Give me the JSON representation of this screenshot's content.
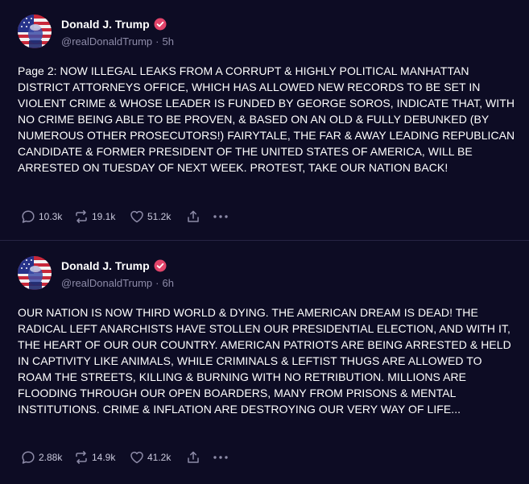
{
  "posts": [
    {
      "author": {
        "display_name": "Donald J. Trump",
        "handle": "@realDonaldTrump",
        "time": "5h",
        "verified_icon": "verified-badge-icon",
        "avatar": "avatar-icon"
      },
      "text": "Page 2: NOW ILLEGAL LEAKS FROM A CORRUPT & HIGHLY POLITICAL MANHATTAN DISTRICT ATTORNEYS OFFICE, WHICH HAS ALLOWED NEW RECORDS TO BE SET IN VIOLENT CRIME & WHOSE LEADER IS FUNDED BY GEORGE SOROS, INDICATE THAT, WITH NO CRIME BEING ABLE TO BE PROVEN, & BASED ON AN OLD & FULLY DEBUNKED (BY NUMEROUS OTHER PROSECUTORS!) FAIRYTALE, THE FAR & AWAY LEADING REPUBLICAN CANDIDATE & FORMER PRESIDENT OF THE UNITED STATES OF AMERICA, WILL BE ARRESTED ON TUESDAY OF NEXT WEEK. PROTEST, TAKE OUR NATION BACK!",
      "stats": {
        "replies": "10.3k",
        "reposts": "19.1k",
        "likes": "51.2k"
      }
    },
    {
      "author": {
        "display_name": "Donald J. Trump",
        "handle": "@realDonaldTrump",
        "time": "6h",
        "verified_icon": "verified-badge-icon",
        "avatar": "avatar-icon"
      },
      "text": "OUR NATION IS NOW THIRD WORLD & DYING. THE AMERICAN DREAM IS DEAD! THE RADICAL LEFT ANARCHISTS HAVE STOLLEN  OUR PRESIDENTIAL ELECTION, AND WITH IT, THE HEART OF OUR OUR COUNTRY. AMERICAN PATRIOTS ARE BEING ARRESTED & HELD IN CAPTIVITY LIKE ANIMALS, WHILE CRIMINALS & LEFTIST THUGS ARE ALLOWED TO ROAM THE STREETS, KILLING & BURNING WITH NO RETRIBUTION. MILLIONS ARE FLOODING THROUGH OUR OPEN BOARDERS, MANY FROM PRISONS & MENTAL INSTITUTIONS. CRIME & INFLATION ARE DESTROYING OUR VERY WAY OF LIFE...",
      "stats": {
        "replies": "2.88k",
        "reposts": "14.9k",
        "likes": "41.2k"
      }
    }
  ],
  "separator": "·",
  "colors": {
    "background": "#0d0c24",
    "muted_text": "#8d8ba8",
    "verified_badge": "#e2446a",
    "divider": "#262444"
  },
  "icons": {
    "reply": "reply-icon",
    "repost": "repost-icon",
    "like": "heart-icon",
    "share": "share-icon",
    "more": "more-options-icon"
  }
}
